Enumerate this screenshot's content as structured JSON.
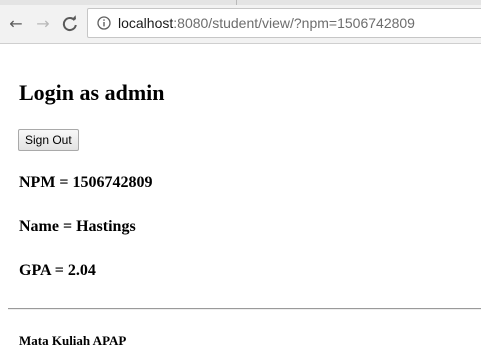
{
  "browser": {
    "nav": {
      "back_icon": "back-arrow-icon",
      "forward_icon": "forward-arrow-icon",
      "reload_icon": "reload-icon"
    },
    "address": {
      "icon": "info-icon",
      "host": "localhost",
      "path": ":8080/student/view/?npm=1506742809"
    }
  },
  "page": {
    "title": "Login as admin",
    "sign_out_label": "Sign Out",
    "npm_line": "NPM = 1506742809",
    "name_line": "Name = Hastings",
    "gpa_line": "GPA = 2.04",
    "section_heading": "Mata Kuliah APAP"
  }
}
